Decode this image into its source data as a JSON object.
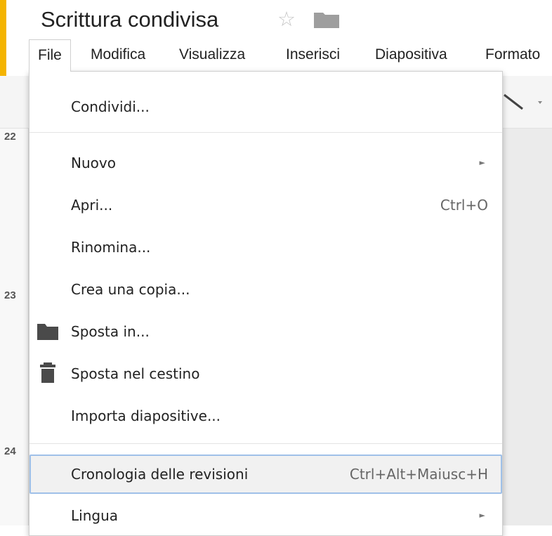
{
  "document": {
    "title": "Scrittura condivisa"
  },
  "menubar": {
    "items": [
      {
        "label": "File"
      },
      {
        "label": "Modifica"
      },
      {
        "label": "Visualizza"
      },
      {
        "label": "Inserisci"
      },
      {
        "label": "Diapositiva"
      },
      {
        "label": "Formato"
      }
    ]
  },
  "ruler": {
    "numbers": [
      "22",
      "23",
      "24"
    ]
  },
  "file_menu": {
    "items": [
      {
        "label": "Condividi..."
      },
      {
        "label": "Nuovo",
        "submenu": true
      },
      {
        "label": "Apri...",
        "shortcut": "Ctrl+O"
      },
      {
        "label": "Rinomina..."
      },
      {
        "label": "Crea una copia..."
      },
      {
        "label": "Sposta in...",
        "icon": "folder-icon"
      },
      {
        "label": "Sposta nel cestino",
        "icon": "trash-icon"
      },
      {
        "label": "Importa diapositive..."
      },
      {
        "label": "Cronologia delle revisioni",
        "shortcut": "Ctrl+Alt+Maiusc+H",
        "highlighted": true
      },
      {
        "label": "Lingua",
        "submenu": true
      }
    ]
  },
  "colors": {
    "accent": "#f4b400",
    "highlight_border": "#9fc0e8"
  }
}
